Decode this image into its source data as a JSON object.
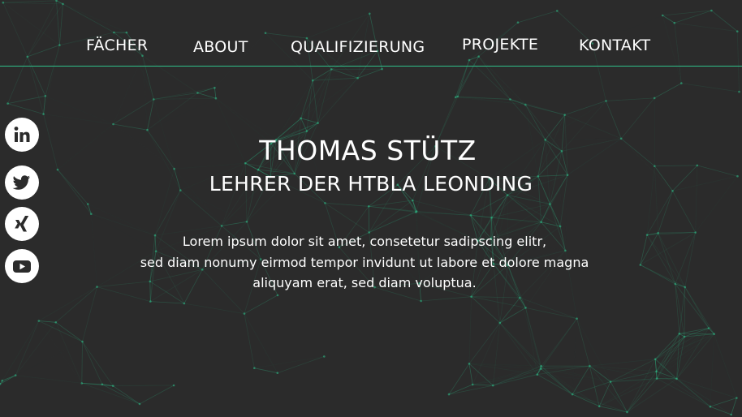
{
  "nav": {
    "items": [
      {
        "label": "FÄCHER"
      },
      {
        "label": "ABOUT"
      },
      {
        "label": "QUALIFIZIERUNG"
      },
      {
        "label": "PROJEKTE"
      },
      {
        "label": "KONTAKT"
      }
    ]
  },
  "social": [
    {
      "icon": "linkedin-icon"
    },
    {
      "icon": "twitter-icon"
    },
    {
      "icon": "xing-icon"
    },
    {
      "icon": "youtube-icon"
    }
  ],
  "hero": {
    "title": "THOMAS STÜTZ",
    "subtitle": "LEHRER DER HTBLA LEONDING",
    "text_lines": [
      "Lorem ipsum dolor sit amet, consetetur sadipscing elitr,",
      "sed diam nonumy eirmod tempor invidunt ut labore et dolore magna",
      "aliquyam erat, sed diam voluptua."
    ]
  },
  "colors": {
    "background": "#2b2b2b",
    "accent": "#2fbf8a",
    "text": "#ffffff"
  }
}
